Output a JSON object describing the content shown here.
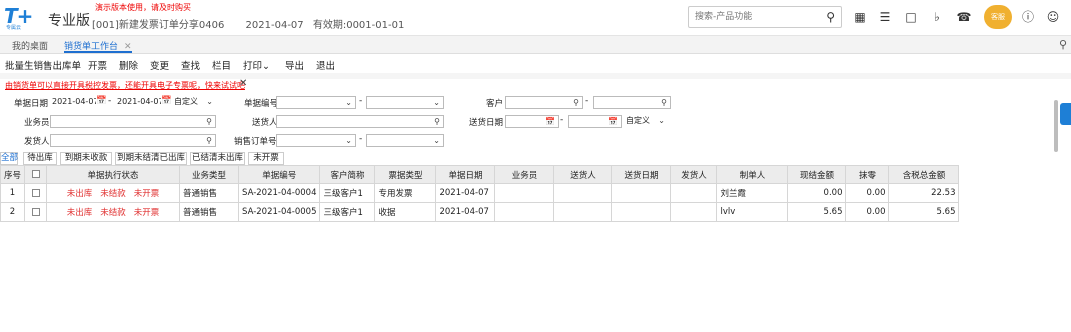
{
  "header": {
    "logo_text": "T+",
    "logo_sub": "专属云",
    "edition": "专业版",
    "demo_tip": "演示版本使用，请及时购买",
    "account": "[001]新建发票订单分享0406",
    "date": "2021-04-07",
    "validity": "有效期:0001-01-01",
    "search_placeholder": "搜索-产品功能",
    "avatar_label": "客服"
  },
  "tabs": [
    {
      "label": "我的桌面",
      "active": false
    },
    {
      "label": "销货单工作台",
      "active": true,
      "close": "✕"
    }
  ],
  "toolbar": [
    "批量生销售出库单",
    "开票",
    "删除",
    "变更",
    "查找",
    "栏目",
    "打印⌄",
    "导出",
    "退出"
  ],
  "notice": {
    "text": "由销货单可以直接开具税控发票，还能开具电子专票呢，快来试试吧",
    "close": "✕"
  },
  "filters": {
    "date_label": "单据日期",
    "date_from": "2021-04-07",
    "date_to": "2021-04-07",
    "date_mode": "自定义",
    "doc_no_label": "单据编号",
    "customer_label": "客户",
    "salesman_label": "业务员",
    "deliverer_label": "送货人",
    "delivery_date_label": "送货日期",
    "delivery_mode": "自定义",
    "shipper_label": "发货人",
    "sales_order_label": "销售订单号",
    "dash": "-"
  },
  "filter_tabs": [
    {
      "label": "全部",
      "active": true
    },
    {
      "label": "待出库",
      "active": false
    },
    {
      "label": "到期未收款",
      "active": false
    },
    {
      "label": "到期未结清已出库",
      "active": false
    },
    {
      "label": "已结清未出库",
      "active": false
    },
    {
      "label": "未开票",
      "active": false
    }
  ],
  "table": {
    "columns": [
      "序号",
      "",
      "单据执行状态",
      "业务类型",
      "单据编号",
      "客户简称",
      "票据类型",
      "单据日期",
      "业务员",
      "送货人",
      "送货日期",
      "发货人",
      "制单人",
      "现结金额",
      "抹零",
      "含税总金额"
    ],
    "rows": [
      {
        "idx": "1",
        "status": [
          "未出库",
          "未结款",
          "未开票"
        ],
        "biz_type": "普通销售",
        "doc_no": "SA-2021-04-0004",
        "customer": "三级客户1",
        "invoice_type": "专用发票",
        "date": "2021-04-07",
        "salesman": "",
        "deliverer": "",
        "delivery_date": "",
        "shipper": "",
        "maker": "刘兰霞",
        "cash": "0.00",
        "rounding": "0.00",
        "total": "22.53"
      },
      {
        "idx": "2",
        "status": [
          "未出库",
          "未结款",
          "未开票"
        ],
        "biz_type": "普通销售",
        "doc_no": "SA-2021-04-0005",
        "customer": "三级客户1",
        "invoice_type": "收据",
        "date": "2021-04-07",
        "salesman": "",
        "deliverer": "",
        "delivery_date": "",
        "shipper": "",
        "maker": "lvlv",
        "cash": "5.65",
        "rounding": "0.00",
        "total": "5.65"
      }
    ]
  }
}
